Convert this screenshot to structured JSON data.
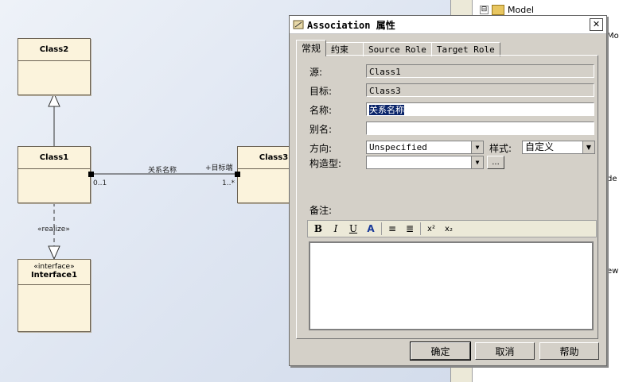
{
  "diagram": {
    "class2": "Class2",
    "class1": "Class1",
    "class3": "Class3",
    "interface_stereotype": "«interface»",
    "interface_name": "Interface1",
    "realize_label": "«realize»",
    "assoc_name": "关系名称",
    "source_mult": "0..1",
    "target_role": "+目标端",
    "target_mult": "1..*"
  },
  "tree": {
    "expander": "⊟",
    "model_label": "Model",
    "side_fragments": [
      "Mo",
      "de",
      "ew"
    ]
  },
  "dialog": {
    "title": "Association 属性",
    "close": "✕",
    "tabs": [
      "常规",
      "约束",
      "Source Role",
      "Target Role"
    ],
    "fields": {
      "source_label": "源:",
      "source_value": "Class1",
      "target_label": "目标:",
      "target_value": "Class3",
      "name_label": "名称:",
      "name_value": "关系名称",
      "alias_label": "别名:",
      "alias_value": "",
      "direction_label": "方向:",
      "direction_value": "Unspecified",
      "style_label": "样式:",
      "style_value": "自定义",
      "stereotype_label": "构造型:",
      "stereotype_value": "",
      "stereotype_button": "...",
      "notes_label": "备注:"
    },
    "toolbar": [
      "B",
      "I",
      "U",
      "A",
      "≡",
      "≣",
      "x²",
      "x₂"
    ],
    "buttons": {
      "ok": "确定",
      "cancel": "取消",
      "help": "帮助"
    }
  }
}
